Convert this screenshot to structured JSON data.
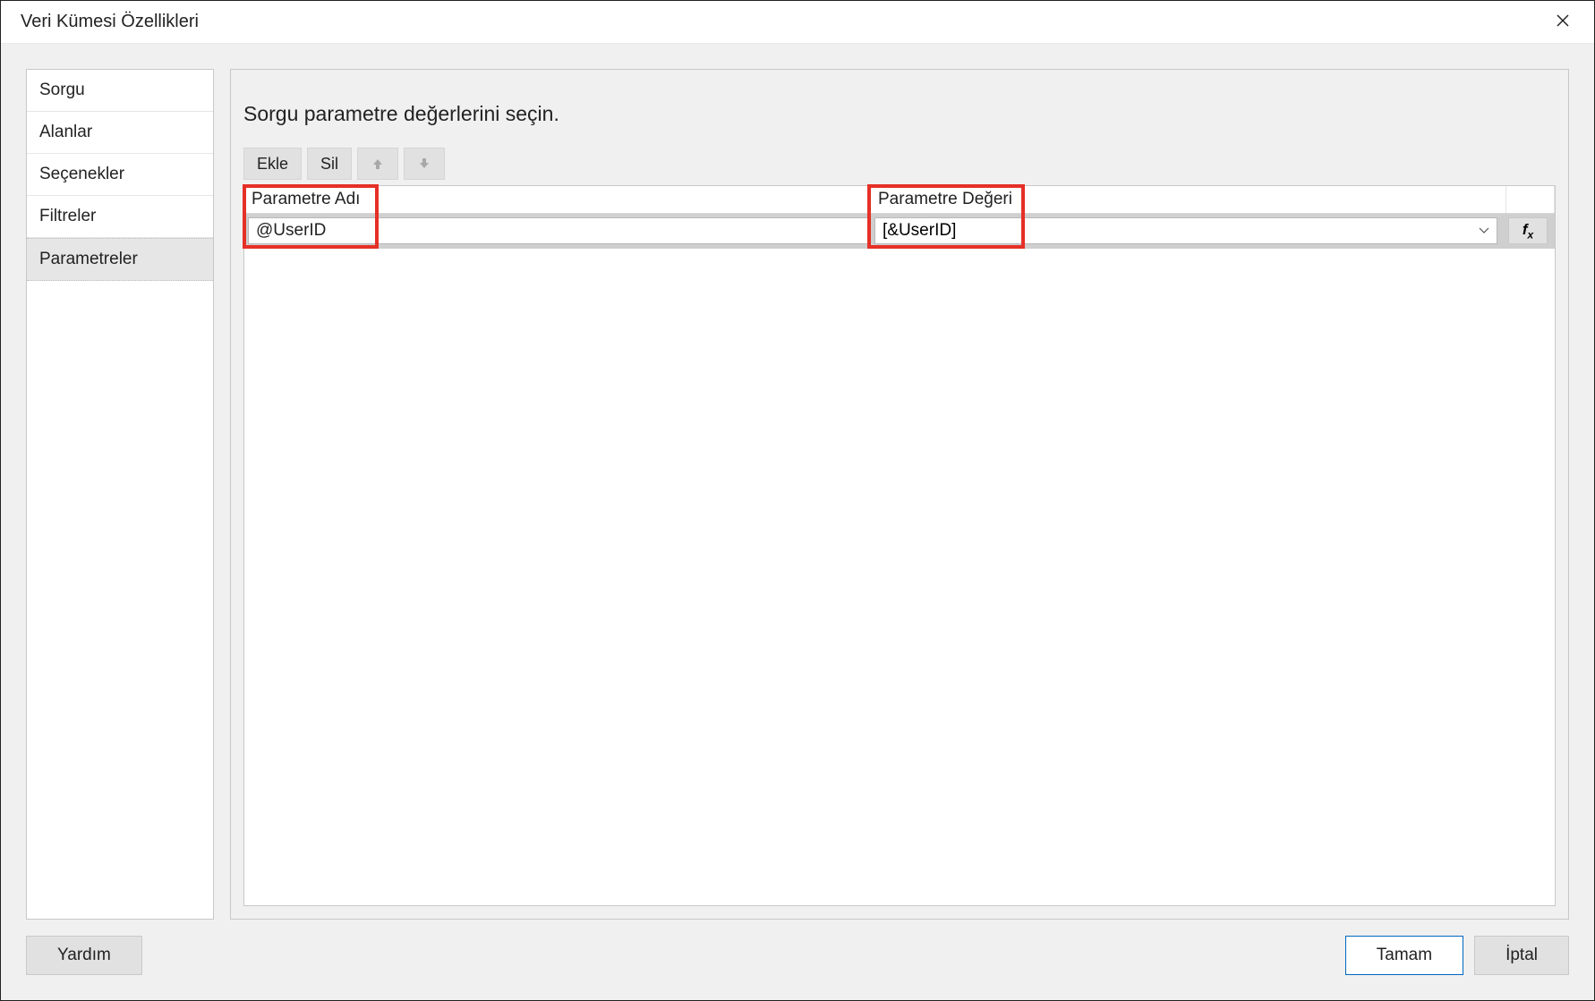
{
  "window": {
    "title": "Veri Kümesi Özellikleri"
  },
  "sidebar": {
    "items": [
      {
        "label": "Sorgu"
      },
      {
        "label": "Alanlar"
      },
      {
        "label": "Seçenekler"
      },
      {
        "label": "Filtreler"
      },
      {
        "label": "Parametreler"
      }
    ],
    "selected_index": 4
  },
  "main": {
    "heading": "Sorgu parametre değerlerini seçin."
  },
  "toolbar": {
    "add_label": "Ekle",
    "delete_label": "Sil"
  },
  "grid": {
    "columns": {
      "name": "Parametre Adı",
      "value": "Parametre Değeri"
    },
    "rows": [
      {
        "name": "@UserID",
        "value": "[&UserID]"
      }
    ]
  },
  "footer": {
    "help_label": "Yardım",
    "ok_label": "Tamam",
    "cancel_label": "İptal"
  }
}
